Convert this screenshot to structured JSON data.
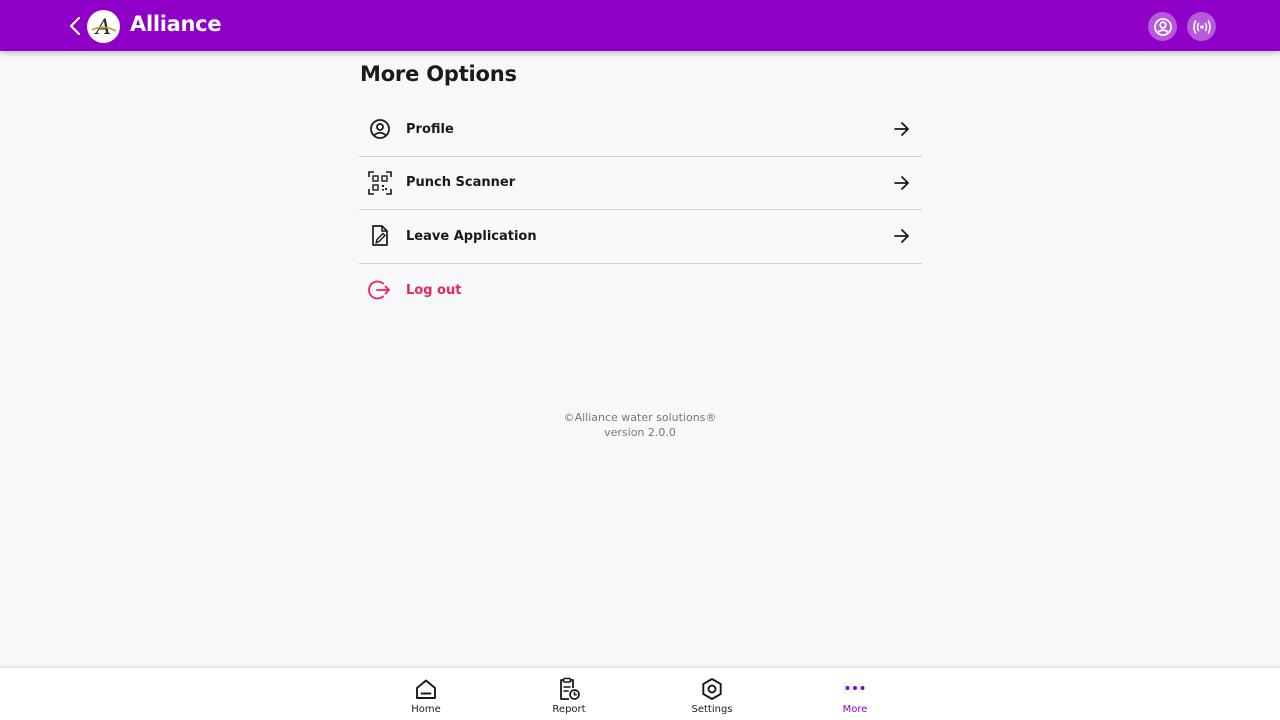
{
  "header": {
    "title": "Alliance",
    "logo_letter": "A",
    "accent_color": "#8f00c9"
  },
  "page": {
    "title": "More Options"
  },
  "menu": {
    "items": [
      {
        "label": "Profile",
        "icon": "user-circle-icon"
      },
      {
        "label": "Punch Scanner",
        "icon": "qr-scan-icon"
      },
      {
        "label": "Leave Application",
        "icon": "document-edit-icon"
      },
      {
        "label": "Log out",
        "icon": "logout-icon",
        "color": "#e8265e"
      }
    ]
  },
  "footer": {
    "copyright": "©Alliance water solutions®",
    "version": "version 2.0.0"
  },
  "bottom_nav": {
    "items": [
      {
        "label": "Home",
        "icon": "home-icon"
      },
      {
        "label": "Report",
        "icon": "report-icon"
      },
      {
        "label": "Settings",
        "icon": "settings-icon"
      },
      {
        "label": "More",
        "icon": "more-dots-icon",
        "active": true
      }
    ]
  }
}
